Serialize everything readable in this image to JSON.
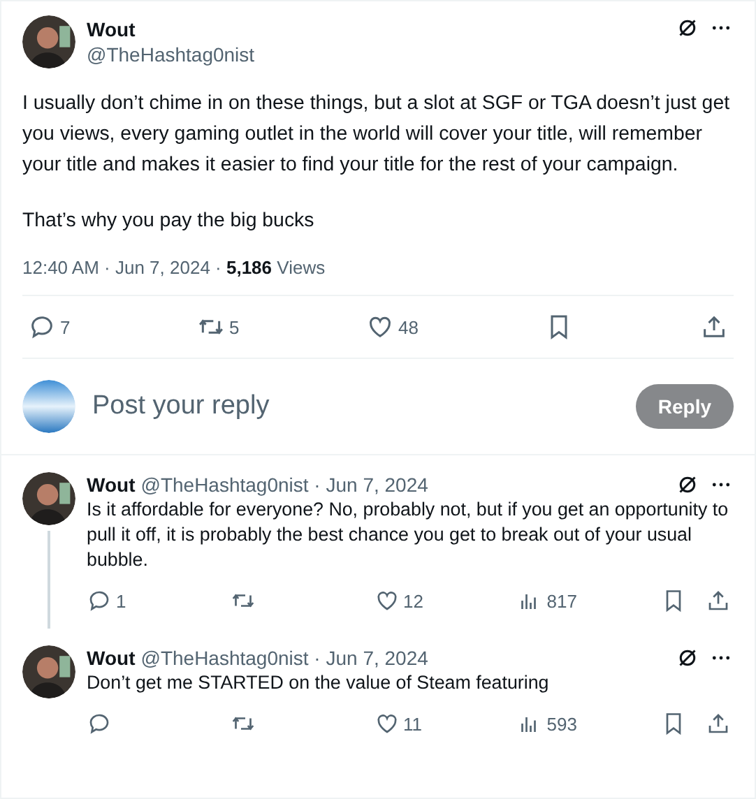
{
  "tweet": {
    "author": {
      "name": "Wout",
      "handle": "@TheHashtag0nist"
    },
    "paragraphs": [
      "I usually don’t chime in on these things, but a slot at SGF or TGA doesn’t just get you views, every gaming outlet in the world will cover your title, will remember your title and makes it easier to find your title for the rest of your campaign.",
      "That’s why you pay the big bucks"
    ],
    "meta": "12:40 AM · Jun 7, 2024 · **5,186** Views",
    "actions": [
      {
        "kind": "reply",
        "count": "7"
      },
      {
        "kind": "repost",
        "count": "5"
      },
      {
        "kind": "like",
        "count": "48"
      },
      {
        "kind": "bookmark"
      },
      {
        "kind": "share"
      }
    ]
  },
  "composer": {
    "placeholder": "Post your reply",
    "button": "Reply",
    "disabled": true
  },
  "replies": [
    {
      "name": "Wout",
      "byline": "@TheHashtag0nist · Jun 7, 2024",
      "text": "Is it affordable for everyone? No, probably not, but if you get an opportunity to pull it off, it is probably the best chance you get to break out of your usual bubble.",
      "thread_line": true,
      "actions": [
        {
          "kind": "reply",
          "count": "1"
        },
        {
          "kind": "repost"
        },
        {
          "kind": "like",
          "count": "12"
        },
        {
          "kind": "views",
          "count": "817"
        },
        {
          "kind": "bookmark"
        },
        {
          "kind": "share"
        }
      ]
    },
    {
      "name": "Wout",
      "byline": "@TheHashtag0nist · Jun 7, 2024",
      "text": "Don’t get me STARTED on the value of Steam featuring",
      "thread_line": false,
      "actions": [
        {
          "kind": "reply"
        },
        {
          "kind": "repost"
        },
        {
          "kind": "like",
          "count": "11"
        },
        {
          "kind": "views",
          "count": "593"
        },
        {
          "kind": "bookmark"
        },
        {
          "kind": "share"
        }
      ]
    }
  ]
}
